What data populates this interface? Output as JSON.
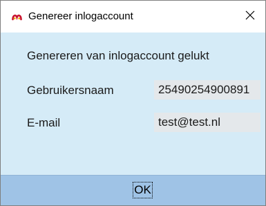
{
  "window": {
    "title": "Genereer inlogaccount",
    "icon": "app-logo-icon",
    "close_icon": "close-icon"
  },
  "content": {
    "message": "Genereren van inlogaccount gelukt",
    "fields": [
      {
        "label": "Gebruikersnaam",
        "value": "25490254900891"
      },
      {
        "label": "E-mail",
        "value": "test@test.nl"
      }
    ]
  },
  "footer": {
    "ok_label": "OK"
  },
  "colors": {
    "content_bg": "#d5ebf7",
    "button_bar_bg": "#9fc3e6",
    "value_field_bg": "#e4e8eb",
    "icon_accent": "#c8102e"
  }
}
